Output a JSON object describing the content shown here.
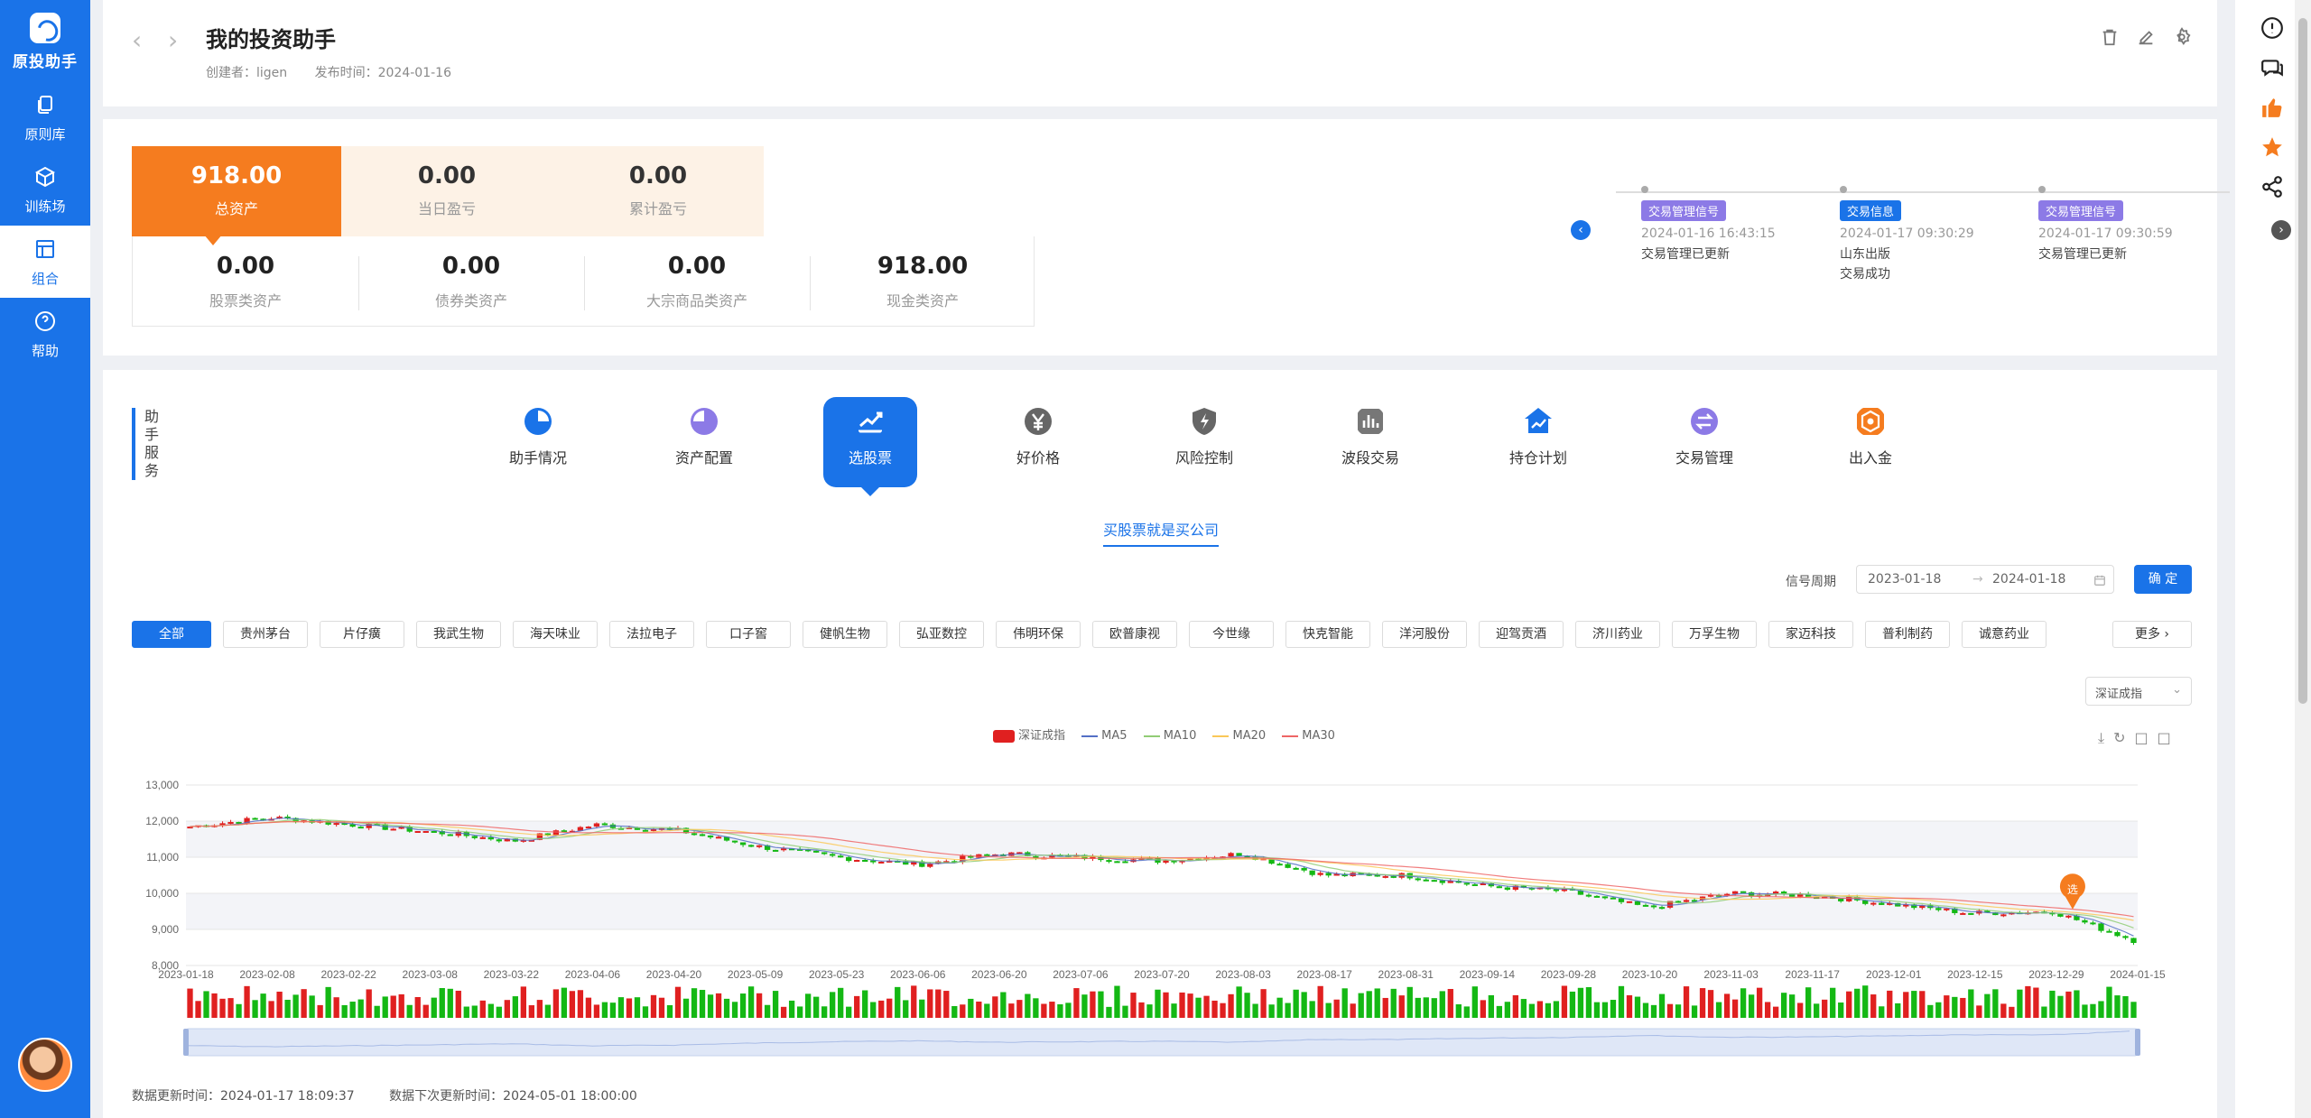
{
  "sidebar": {
    "brand": "原投助手",
    "items": [
      {
        "label": "原则库",
        "icon": "copy-icon"
      },
      {
        "label": "训练场",
        "icon": "cube-icon"
      },
      {
        "label": "组合",
        "icon": "layout-icon"
      },
      {
        "label": "帮助",
        "icon": "help-icon"
      }
    ],
    "active": "组合"
  },
  "header": {
    "title": "我的投资助手",
    "creator": "创建者：ligen",
    "published": "发布时间：2024-01-16"
  },
  "stats": {
    "total": {
      "value": "918.00",
      "label": "总资产"
    },
    "daily": {
      "value": "0.00",
      "label": "当日盈亏"
    },
    "cumulative": {
      "value": "0.00",
      "label": "累计盈亏"
    },
    "sub": [
      {
        "value": "0.00",
        "label": "股票类资产"
      },
      {
        "value": "0.00",
        "label": "债券类资产"
      },
      {
        "value": "0.00",
        "label": "大宗商品类资产"
      },
      {
        "value": "918.00",
        "label": "现金类资产"
      }
    ]
  },
  "timeline": [
    {
      "tag": "交易管理信号",
      "tag_color": "#8c7ae6",
      "time": "2024-01-16 16:43:15",
      "lines": [
        "交易管理已更新"
      ]
    },
    {
      "tag": "交易信息",
      "tag_color": "#1a73e8",
      "time": "2024-01-17 09:30:29",
      "lines": [
        "山东出版",
        "交易成功"
      ]
    },
    {
      "tag": "交易管理信号",
      "tag_color": "#8c7ae6",
      "time": "2024-01-17 09:30:59",
      "lines": [
        "交易管理已更新"
      ]
    }
  ],
  "services": {
    "label": "助手服务",
    "items": [
      {
        "label": "助手情况",
        "icon": "pie-icon",
        "color": "#1a73e8"
      },
      {
        "label": "资产配置",
        "icon": "pie-chart-icon",
        "color": "#8c7ae6"
      },
      {
        "label": "选股票",
        "icon": "trend-icon",
        "color": "#1a73e8"
      },
      {
        "label": "好价格",
        "icon": "yen-icon",
        "color": "#666666"
      },
      {
        "label": "风险控制",
        "icon": "shield-bolt-icon",
        "color": "#666666"
      },
      {
        "label": "波段交易",
        "icon": "bar-icon",
        "color": "#777777"
      },
      {
        "label": "持仓计划",
        "icon": "house-chart-icon",
        "color": "#1a73e8"
      },
      {
        "label": "交易管理",
        "icon": "swap-icon",
        "color": "#8c7ae6"
      },
      {
        "label": "出入金",
        "icon": "wallet-icon",
        "color": "#f57c1f"
      }
    ],
    "active": "选股票"
  },
  "subtab": "买股票就是买公司",
  "filter": {
    "period_label": "信号周期",
    "start": "2023-01-18",
    "end": "2024-01-18",
    "confirm": "确 定"
  },
  "stocks": [
    "全部",
    "贵州茅台",
    "片仔癀",
    "我武生物",
    "海天味业",
    "法拉电子",
    "口子窖",
    "健帆生物",
    "弘亚数控",
    "伟明环保",
    "欧普康视",
    "今世缘",
    "快克智能",
    "洋河股份",
    "迎驾贡酒",
    "济川药业",
    "万孚生物",
    "家迈科技",
    "普利制药",
    "诚意药业"
  ],
  "stocks_active": "全部",
  "more": "更多",
  "index_select": "深证成指",
  "legend": {
    "main": "深证成指",
    "ma": [
      "MA5",
      "MA10",
      "MA20",
      "MA30"
    ],
    "ma_colors": [
      "#5470c6",
      "#91cc75",
      "#fac858",
      "#ee6666"
    ]
  },
  "chart_data": {
    "type": "candlestick",
    "title": "",
    "series_name": "深证成指",
    "ylim": [
      8000,
      13000
    ],
    "yticks": [
      "13,000",
      "12,000",
      "11,000",
      "10,000",
      "9,000",
      "8,000"
    ],
    "xticks": [
      "2023-01-18",
      "2023-02-08",
      "2023-02-22",
      "2023-03-08",
      "2023-03-22",
      "2023-04-06",
      "2023-04-20",
      "2023-05-09",
      "2023-05-23",
      "2023-06-06",
      "2023-06-20",
      "2023-07-06",
      "2023-07-20",
      "2023-08-03",
      "2023-08-17",
      "2023-08-31",
      "2023-09-14",
      "2023-09-28",
      "2023-10-20",
      "2023-11-03",
      "2023-11-17",
      "2023-12-01",
      "2023-12-15",
      "2023-12-29",
      "2024-01-15"
    ],
    "close_path": [
      [
        "2023-01-18",
        11850
      ],
      [
        "2023-02-08",
        12100
      ],
      [
        "2023-02-22",
        11900
      ],
      [
        "2023-03-08",
        11700
      ],
      [
        "2023-03-22",
        11450
      ],
      [
        "2023-04-06",
        11900
      ],
      [
        "2023-04-20",
        11750
      ],
      [
        "2023-05-09",
        11300
      ],
      [
        "2023-05-23",
        11000
      ],
      [
        "2023-06-06",
        10800
      ],
      [
        "2023-06-20",
        11100
      ],
      [
        "2023-07-06",
        11000
      ],
      [
        "2023-07-20",
        10900
      ],
      [
        "2023-08-03",
        11100
      ],
      [
        "2023-08-17",
        10500
      ],
      [
        "2023-08-31",
        10500
      ],
      [
        "2023-09-14",
        10200
      ],
      [
        "2023-09-28",
        10050
      ],
      [
        "2023-10-20",
        9600
      ],
      [
        "2023-11-03",
        10000
      ],
      [
        "2023-11-17",
        9950
      ],
      [
        "2023-12-01",
        9700
      ],
      [
        "2023-12-15",
        9450
      ],
      [
        "2023-12-29",
        9500
      ],
      [
        "2024-01-15",
        8700
      ]
    ],
    "marker_label": "选"
  },
  "footer": {
    "updated": "数据更新时间：2024-01-17 18:09:37",
    "next": "数据下次更新时间：2024-05-01 18:00:00"
  }
}
